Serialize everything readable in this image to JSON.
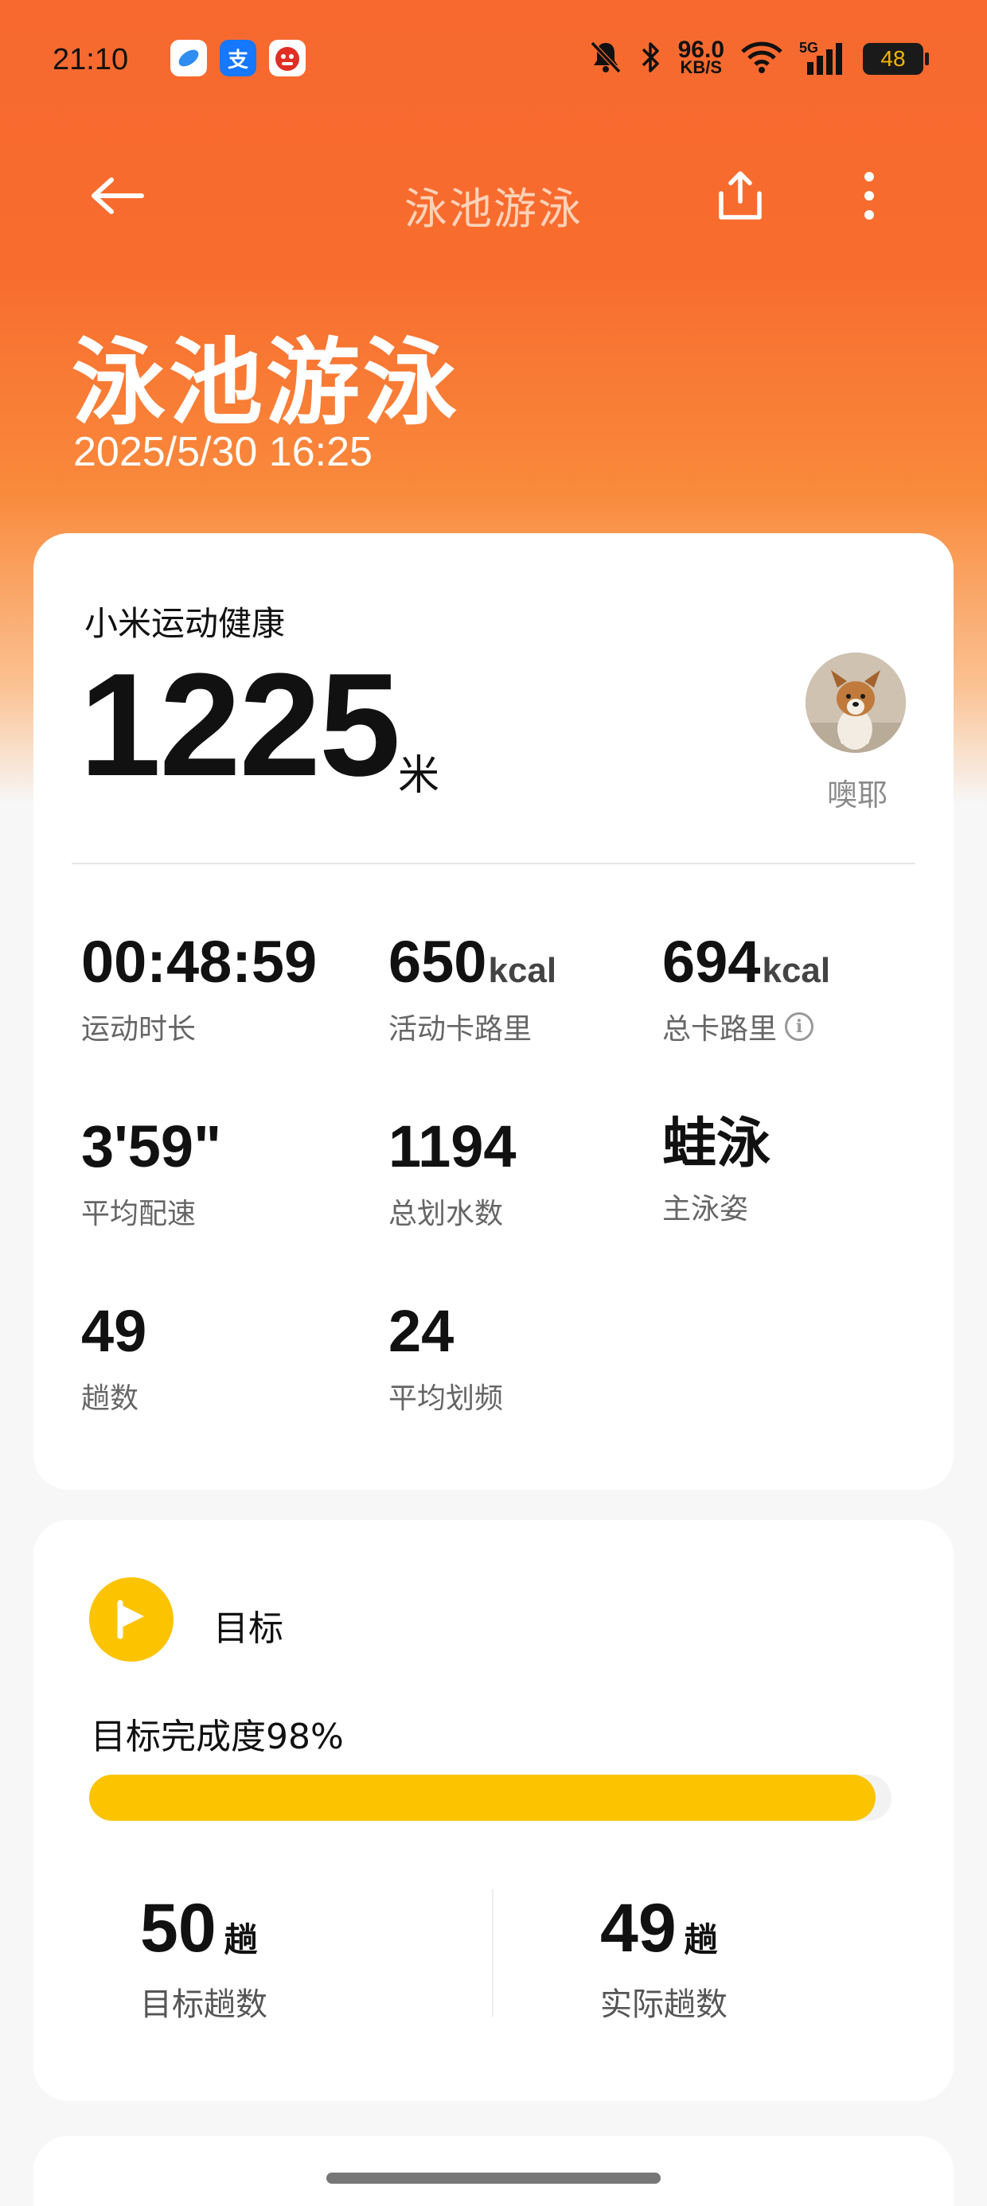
{
  "status_bar": {
    "time": "21:10",
    "apps": [
      "browser-icon",
      "alipay-icon",
      "pinduoduo-icon"
    ],
    "net_speed_value": "96.0",
    "net_speed_unit": "KB/S",
    "network": "5G",
    "battery": "48"
  },
  "nav": {
    "title": "泳池游泳"
  },
  "hero": {
    "title": "泳池游泳",
    "datetime": "2025/5/30 16:25"
  },
  "summary": {
    "source": "小米运动健康",
    "distance": "1225",
    "distance_unit": "米",
    "user_name": "噢耶",
    "stats": [
      {
        "value": "00:48:59",
        "unit": "",
        "label": "运动时长"
      },
      {
        "value": "650",
        "unit": "kcal",
        "label": "活动卡路里"
      },
      {
        "value": "694",
        "unit": "kcal",
        "label": "总卡路里"
      },
      {
        "value": "3'59\"",
        "unit": "",
        "label": "平均配速"
      },
      {
        "value": "1194",
        "unit": "",
        "label": "总划水数"
      },
      {
        "value": "蛙泳",
        "unit": "",
        "label": "主泳姿"
      },
      {
        "value": "49",
        "unit": "",
        "label": "趟数"
      },
      {
        "value": "24",
        "unit": "",
        "label": "平均划频"
      }
    ]
  },
  "goal": {
    "title": "目标",
    "completion_text": "目标完成度98%",
    "completion": 0.98,
    "target_value": "50",
    "target_unit": "趟",
    "target_label": "目标趟数",
    "actual_value": "49",
    "actual_unit": "趟",
    "actual_label": "实际趟数"
  },
  "colors": {
    "brand_orange": "#f7692f",
    "goal_yellow": "#fcc400"
  }
}
